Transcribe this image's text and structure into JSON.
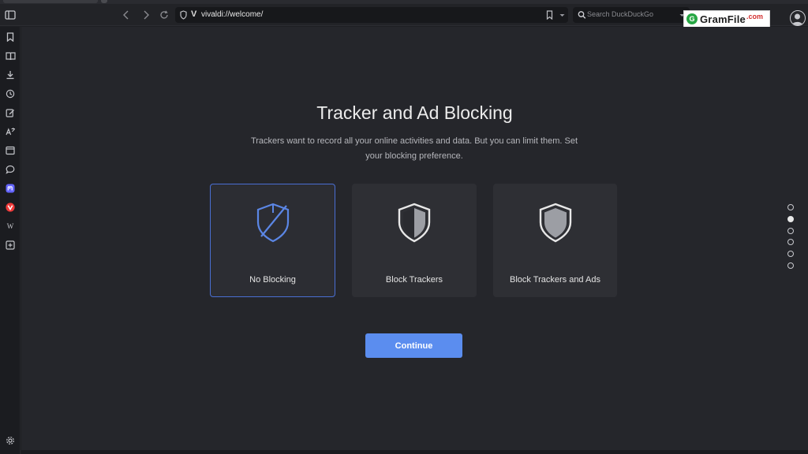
{
  "browser": {
    "url": "vivaldi://welcome/",
    "search_placeholder": "Search DuckDuckGo"
  },
  "watermark": {
    "brand": "GramFile",
    "suffix": ".com",
    "logo_letter": "G"
  },
  "sidebar": {
    "icons": [
      "bookmarks-icon",
      "reading-list-icon",
      "downloads-icon",
      "history-icon",
      "notes-icon",
      "translate-icon",
      "window-panel-icon",
      "chat-icon",
      "mastodon-icon",
      "vivaldi-icon",
      "wikipedia-icon",
      "add-panel-icon"
    ],
    "wikipedia_glyph": "W",
    "settings_icon": "gear-icon"
  },
  "page": {
    "title": "Tracker and Ad Blocking",
    "subtitle": "Trackers want to record all your online activities and data. But you can limit them. Set your blocking preference.",
    "options": [
      {
        "label": "No Blocking",
        "icon": "shield-slash-icon",
        "selected": true
      },
      {
        "label": "Block Trackers",
        "icon": "shield-half-icon",
        "selected": false
      },
      {
        "label": "Block Trackers and Ads",
        "icon": "shield-full-icon",
        "selected": false
      }
    ],
    "continue_label": "Continue",
    "steps_total": 6,
    "steps_active_index": 1
  },
  "colors": {
    "accent": "#5b8def",
    "selected_border": "#4a6fd4",
    "background": "#25262b",
    "mastodon": "#6364ff",
    "vivaldi": "#ef3939"
  }
}
